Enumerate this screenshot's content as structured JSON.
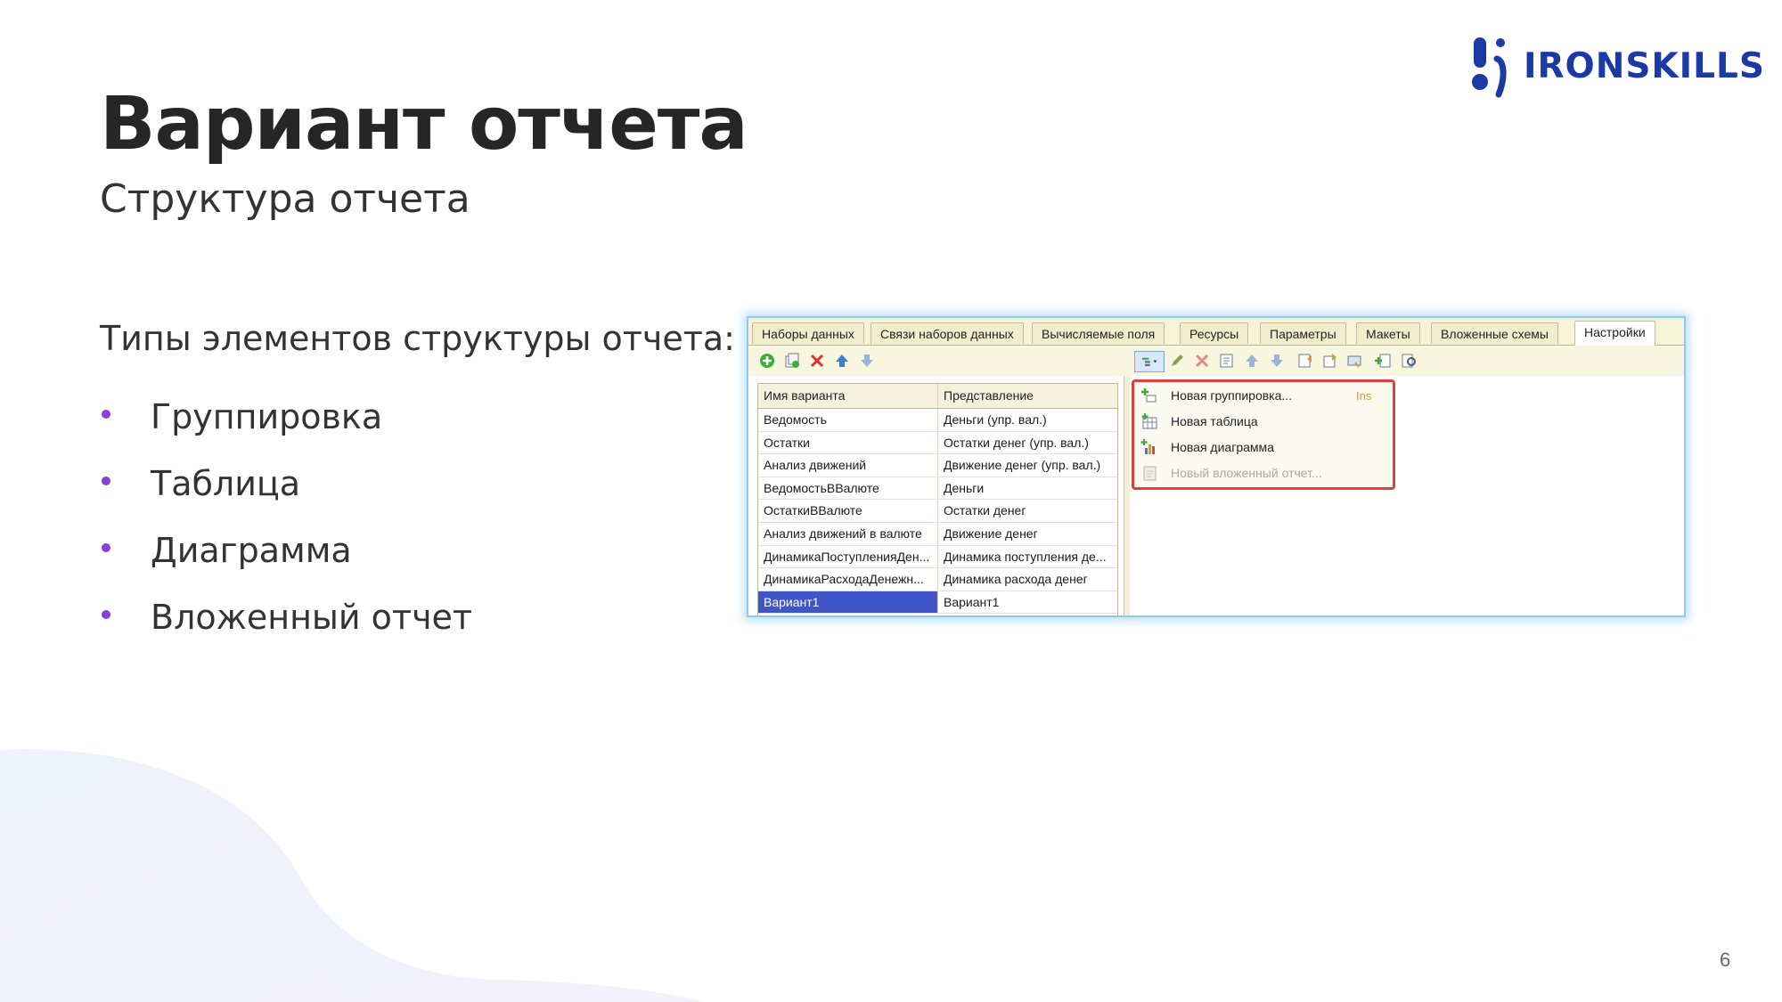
{
  "brand": {
    "name": "IRONSKILLS",
    "color": "#1c3aa6"
  },
  "slide": {
    "title": "Вариант отчета",
    "subtitle": "Структура отчета",
    "lead": "Типы элементов структуры отчета:",
    "bullets": [
      "Группировка",
      "Таблица",
      "Диаграмма",
      "Вложенный отчет"
    ],
    "bullet_color": "#8b3fd6",
    "page_number": "6"
  },
  "window": {
    "tabs": [
      "Наборы данных",
      "Связи наборов данных",
      "Вычисляемые поля",
      "Ресурсы",
      "Параметры",
      "Макеты",
      "Вложенные схемы",
      "Настройки"
    ],
    "active_tab": "Настройки",
    "left_toolbar": [
      "add-icon",
      "copy-icon",
      "delete-icon",
      "move-up-icon",
      "move-down-icon"
    ],
    "right_toolbar": [
      "add-structure-dropdown-icon",
      "edit-icon",
      "delete-icon",
      "properties-icon",
      "move-up-icon",
      "move-down-icon",
      "group-icon",
      "ungroup-icon",
      "settings-icon",
      "add-field-icon",
      "find-icon"
    ],
    "grid": {
      "columns": [
        "Имя варианта",
        "Представление"
      ],
      "rows": [
        [
          "Ведомость",
          "Деньги (упр. вал.)"
        ],
        [
          "Остатки",
          "Остатки денег (упр. вал.)"
        ],
        [
          "Анализ движений",
          "Движение денег (упр. вал.)"
        ],
        [
          "ВедомостьВВалюте",
          "Деньги"
        ],
        [
          "ОстаткиВВалюте",
          "Остатки денег"
        ],
        [
          "Анализ движений в валюте",
          "Движение денег"
        ],
        [
          "ДинамикаПоступленияДен...",
          "Динамика поступления де..."
        ],
        [
          "ДинамикаРасходаДенежн...",
          "Динамика расхода денег"
        ],
        [
          "Вариант1",
          "Вариант1"
        ]
      ],
      "selected_row": "Вариант1"
    },
    "menu": {
      "items": [
        {
          "label": "Новая группировка...",
          "shortcut": "Ins",
          "icon": "new-grouping-icon",
          "enabled": true
        },
        {
          "label": "Новая таблица",
          "shortcut": "",
          "icon": "new-table-icon",
          "enabled": true
        },
        {
          "label": "Новая диаграмма",
          "shortcut": "",
          "icon": "new-chart-icon",
          "enabled": true
        },
        {
          "label": "Новый вложенный отчет...",
          "shortcut": "",
          "icon": "new-nested-report-icon",
          "enabled": false
        }
      ],
      "highlight_color": "#e0403a"
    }
  }
}
